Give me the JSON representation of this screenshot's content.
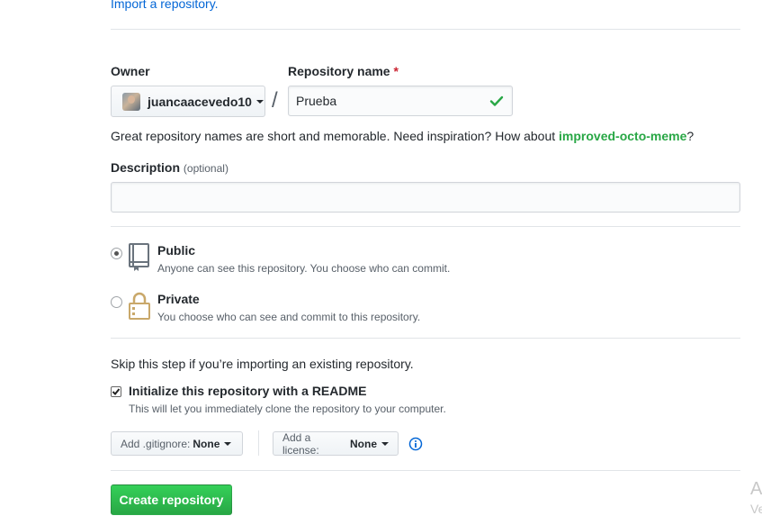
{
  "import": {
    "link_text": "Import a repository."
  },
  "owner": {
    "label": "Owner",
    "value": "juancaacevedo10"
  },
  "repo_name": {
    "label": "Repository name",
    "required_mark": "*",
    "value": "Prueba"
  },
  "name_hint": {
    "prefix": "Great repository names are short and memorable. Need inspiration? How about ",
    "suggestion": "improved-octo-meme",
    "suffix": "?"
  },
  "description": {
    "label": "Description",
    "optional": "(optional)",
    "value": "",
    "placeholder": ""
  },
  "visibility": {
    "selected": "public",
    "public": {
      "title": "Public",
      "desc": "Anyone can see this repository. You choose who can commit."
    },
    "private": {
      "title": "Private",
      "desc": "You choose who can see and commit to this repository."
    }
  },
  "init": {
    "skip_note": "Skip this step if you’re importing an existing repository.",
    "readme_label": "Initialize this repository with a README",
    "readme_checked": true,
    "readme_desc": "This will let you immediately clone the repository to your computer."
  },
  "gitignore": {
    "prefix": "Add .gitignore:",
    "value": "None"
  },
  "license": {
    "prefix": "Add a license:",
    "value": "None"
  },
  "create_button": {
    "label": "Create repository"
  },
  "watermark": {
    "line1": "A",
    "line2": "Ve"
  },
  "colors": {
    "success": "#28a745",
    "link": "#0366d6",
    "required": "#cb2431"
  },
  "icons": {
    "check": "check-icon",
    "repo": "repo-book-icon",
    "lock": "lock-icon",
    "info": "info-icon"
  }
}
